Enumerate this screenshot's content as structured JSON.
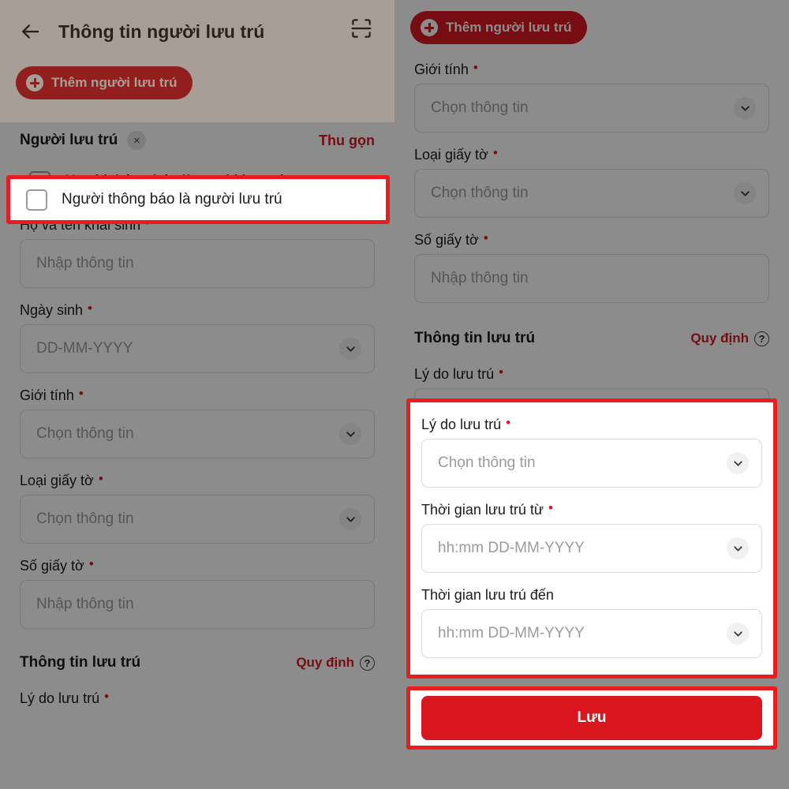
{
  "header": {
    "title": "Thông tin người lưu trú",
    "back_icon": "back-arrow-icon",
    "scan_icon": "scan-qr-icon",
    "add_button_label": "Thêm người lưu trú"
  },
  "left_panel": {
    "section": {
      "title": "Người lưu trú",
      "close_chip": "×",
      "collapse_label": "Thu gọn"
    },
    "checkbox": {
      "label": "Người thông báo là người lưu trú",
      "checked": false
    },
    "fields": [
      {
        "label": "Họ và tên khai sinh",
        "required": true,
        "placeholder": "Nhập thông tin",
        "type": "text"
      },
      {
        "label": "Ngày sinh",
        "required": true,
        "placeholder": "DD-MM-YYYY",
        "type": "select"
      },
      {
        "label": "Giới tính",
        "required": true,
        "placeholder": "Chọn thông tin",
        "type": "select"
      },
      {
        "label": "Loại giấy tờ",
        "required": true,
        "placeholder": "Chọn thông tin",
        "type": "select"
      },
      {
        "label": "Số giấy tờ",
        "required": true,
        "placeholder": "Nhập thông tin",
        "type": "text"
      }
    ],
    "stay_section": {
      "title": "Thông tin lưu trú",
      "rule_label": "Quy định",
      "rule_icon": "question-circle-icon"
    },
    "stay_first_label": "Lý do lưu trú",
    "stay_first_required": true
  },
  "right_panel": {
    "add_button_label": "Thêm người lưu trú",
    "fields": [
      {
        "label": "Giới tính",
        "required": true,
        "placeholder": "Chọn thông tin",
        "type": "select"
      },
      {
        "label": "Loại giấy tờ",
        "required": true,
        "placeholder": "Chọn thông tin",
        "type": "select"
      },
      {
        "label": "Số giấy tờ",
        "required": true,
        "placeholder": "Nhập thông tin",
        "type": "text"
      }
    ],
    "stay_section": {
      "title": "Thông tin lưu trú",
      "rule_label": "Quy định",
      "rule_icon": "question-circle-icon"
    },
    "stay_fields": [
      {
        "label": "Lý do lưu trú",
        "required": true,
        "placeholder": "Chọn thông tin",
        "type": "select"
      },
      {
        "label": "Thời gian lưu trú từ",
        "required": true,
        "placeholder": "hh:mm DD-MM-YYYY",
        "type": "select"
      },
      {
        "label": "Thời gian lưu trú đến",
        "required": false,
        "placeholder": "hh:mm DD-MM-YYYY",
        "type": "select"
      }
    ],
    "save_button_label": "Lưu"
  },
  "colors": {
    "brand_red": "#d71921",
    "highlight_red": "#e81e1e",
    "save_red": "#d9161e",
    "text_dark": "#1b1b1b",
    "placeholder_gray": "#9b9b9b",
    "scrim": "rgba(0,0,0,0.45)"
  },
  "required_marker": "•"
}
